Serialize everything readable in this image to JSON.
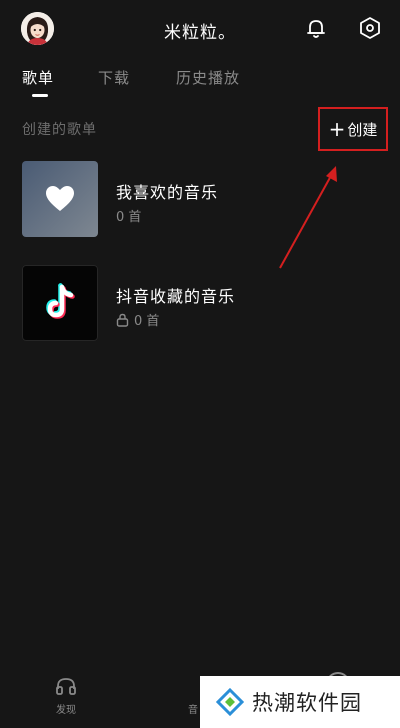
{
  "header": {
    "username": "米粒粒。",
    "icons": [
      "avatar",
      "bell-icon",
      "settings-icon"
    ]
  },
  "tabs": [
    {
      "label": "歌单",
      "active": true
    },
    {
      "label": "下载",
      "active": false
    },
    {
      "label": "历史播放",
      "active": false
    }
  ],
  "section": {
    "title": "创建的歌单",
    "create_label": "创建"
  },
  "playlists": [
    {
      "name": "我喜欢的音乐",
      "count": "0 首",
      "locked": false,
      "cover": "heart-icon"
    },
    {
      "name": "抖音收藏的音乐",
      "count": "0 首",
      "locked": true,
      "cover": "tiktok-logo"
    }
  ],
  "bottom_nav": [
    {
      "label": "发现",
      "icon": "headphones-icon"
    },
    {
      "label": "音",
      "icon": "music-bar-icon"
    }
  ],
  "watermark": {
    "text": "热潮软件园"
  },
  "colors": {
    "background": "#161616",
    "annotation": "#d41f1f",
    "muted_text": "#8a8a8a"
  }
}
